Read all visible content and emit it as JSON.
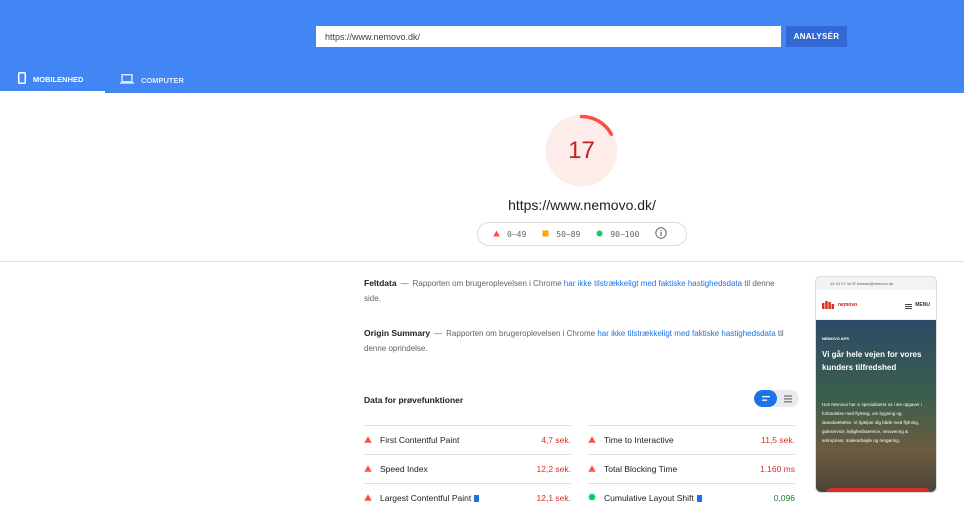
{
  "header": {
    "url_value": "https://www.nemovo.dk/",
    "analyze_label": "ANALYSÉR",
    "tabs": [
      {
        "label": "MOBILENHED",
        "icon": "smartphone-icon",
        "active": true
      },
      {
        "label": "COMPUTER",
        "icon": "laptop-icon",
        "active": false
      }
    ],
    "accent_color": "#4285f4"
  },
  "score": {
    "value": "17",
    "fraction": 0.17,
    "color": "#ff4e42"
  },
  "page_url": "https://www.nemovo.dk/",
  "legend": [
    {
      "icon": "triangle-red-icon",
      "label": "0–49",
      "color": "#ff4e42"
    },
    {
      "icon": "square-orange-icon",
      "label": "50–89",
      "color": "#ffa400"
    },
    {
      "icon": "circle-green-icon",
      "label": "90–100",
      "color": "#0cce6b"
    }
  ],
  "field_data": {
    "title": "Feltdata",
    "text_before": "Rapporten om brugeroplevelsen i Chrome",
    "link": "har ikke tilstrækkeligt med faktiske hastighedsdata",
    "text_after": "til denne side."
  },
  "origin_summary": {
    "title": "Origin Summary",
    "text_before": "Rapporten om brugeroplevelsen i Chrome",
    "link": "har ikke tilstrækkeligt med faktiske hastighedsdata",
    "text_after": "til denne oprindelse."
  },
  "diagnostics": {
    "title": "Data for prøvefunktioner",
    "metrics": [
      {
        "name": "First Contentful Paint",
        "value": "4,7 sek.",
        "status": "red",
        "flag": false
      },
      {
        "name": "Time to Interactive",
        "value": "11,5 sek.",
        "status": "red",
        "flag": false
      },
      {
        "name": "Speed Index",
        "value": "12,2 sek.",
        "status": "red",
        "flag": false
      },
      {
        "name": "Total Blocking Time",
        "value": "1.160 ms",
        "status": "red",
        "flag": false
      },
      {
        "name": "Largest Contentful Paint",
        "value": "12,1 sek.",
        "status": "red",
        "flag": true
      },
      {
        "name": "Cumulative Layout Shift",
        "value": "0,096",
        "status": "green",
        "flag": true
      }
    ]
  },
  "screenshot": {
    "topbar_text": "44 44 07 44   ✉ kontakt@nemovo.dk",
    "brand": "nemovo",
    "menu_label": "MENU",
    "kicker": "NEMOVO APS",
    "headline": "Vi går hele vejen for vores kunders tilfredshed",
    "body": "Hos Nemovo har vi specialiseret os i ste opgaver i forbindelse med flytning, om bygning og istandsættelse. Vi hjælper dig både med flytning, gulvservice, lejlighedsservice, renovering & entrepriser, malerarbejde og rengøring."
  }
}
